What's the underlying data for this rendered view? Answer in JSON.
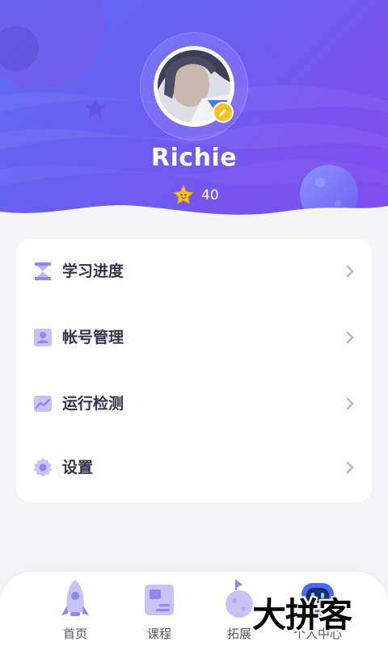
{
  "profile": {
    "username": "Richie",
    "points": "40"
  },
  "menu": {
    "items": [
      {
        "label": "学习进度",
        "icon": "hourglass-icon"
      },
      {
        "label": "帐号管理",
        "icon": "user-card-icon"
      },
      {
        "label": "运行检测",
        "icon": "chart-icon"
      },
      {
        "label": "设置",
        "icon": "gear-icon"
      }
    ]
  },
  "nav": {
    "items": [
      {
        "label": "首页",
        "icon": "rocket-icon"
      },
      {
        "label": "课程",
        "icon": "course-board-icon"
      },
      {
        "label": "拓展",
        "icon": "planet-icon"
      },
      {
        "label": "个人中心",
        "icon": "robot-icon"
      }
    ],
    "active_index": 3
  },
  "watermark": {
    "text": "大拼客"
  },
  "colors": {
    "header_gradient_start": "#5a6df5",
    "header_gradient_end": "#7d4ff0",
    "accent_purple": "#8f86f0",
    "star_yellow": "#f7c21c",
    "page_bg": "#f5f5f8"
  }
}
